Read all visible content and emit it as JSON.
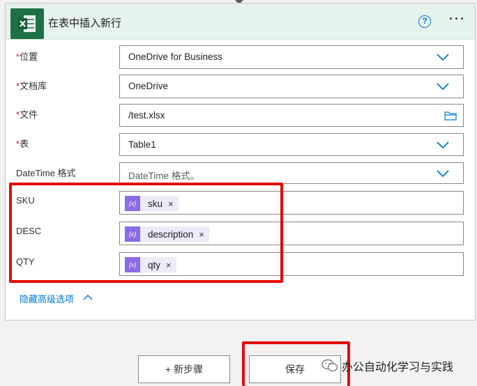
{
  "card": {
    "title": "在表中插入新行",
    "help_symbol": "?",
    "more_symbol": "···",
    "icon": "excel-icon"
  },
  "fields": [
    {
      "label": "位置",
      "required": true,
      "value": "OneDrive for Business",
      "control": "dropdown"
    },
    {
      "label": "文档库",
      "required": true,
      "value": "OneDrive",
      "control": "dropdown"
    },
    {
      "label": "文件",
      "required": true,
      "value": "/test.xlsx",
      "control": "file-picker"
    },
    {
      "label": "表",
      "required": true,
      "value": "Table1",
      "control": "dropdown"
    },
    {
      "label": "DateTime 格式",
      "required": false,
      "placeholder": "DateTime 格式。",
      "control": "dropdown"
    }
  ],
  "columns": [
    {
      "label": "SKU",
      "token": "sku"
    },
    {
      "label": "DESC",
      "token": "description"
    },
    {
      "label": "QTY",
      "token": "qty"
    }
  ],
  "token_icon_text": "{x}",
  "token_close": "×",
  "required_mark": "*",
  "hide_advanced": "隐藏高级选项",
  "buttons": {
    "new_step": "+ 新步骤",
    "save": "保存"
  },
  "watermark": "办公自动化学习与实践",
  "colors": {
    "accent": "#0078d4",
    "excel_green": "#1e7145",
    "token_purple": "#8c6ce5",
    "highlight_red": "#e30b0b"
  }
}
